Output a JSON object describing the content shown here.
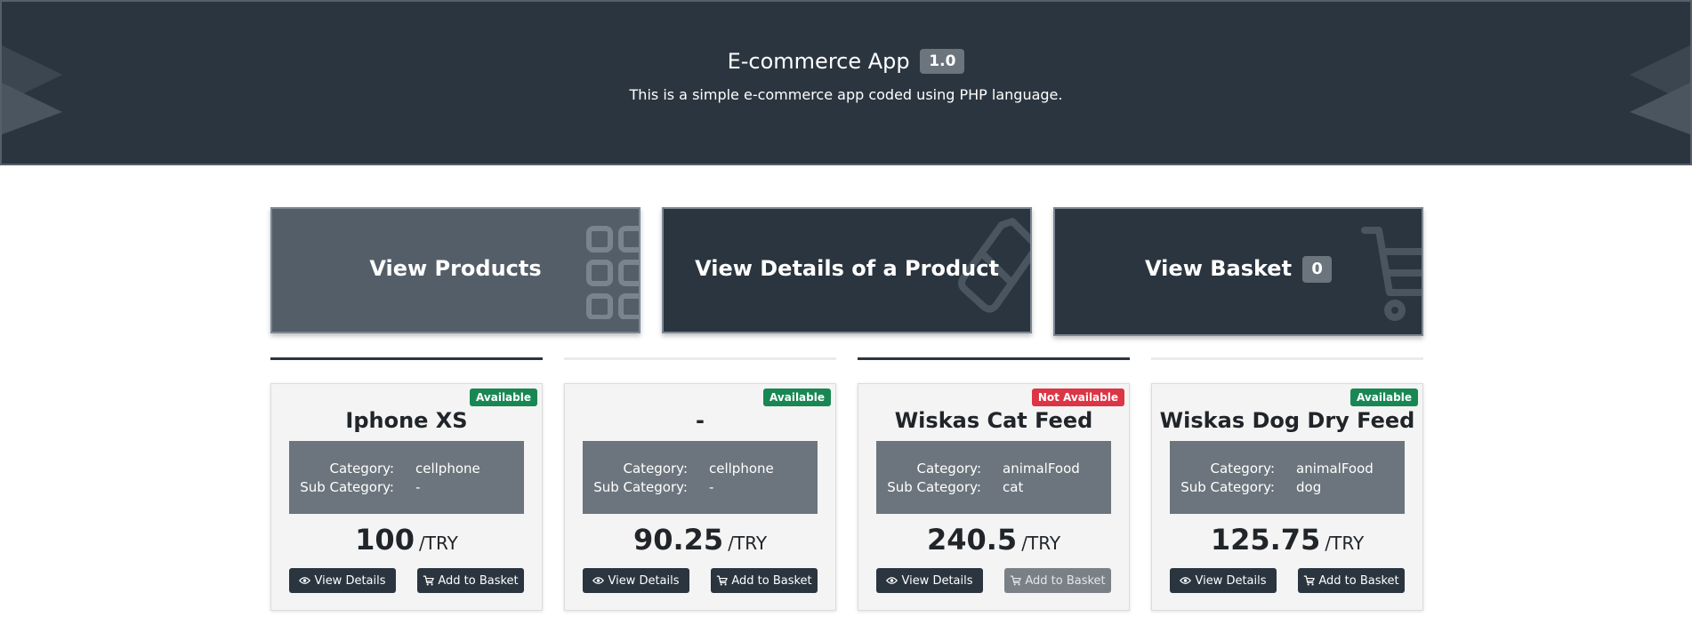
{
  "header": {
    "title": "E-commerce App",
    "version": "1.0",
    "subtitle": "This is a simple e-commerce app coded using PHP language."
  },
  "nav": {
    "products_label": "View Products",
    "details_label": "View Details of a Product",
    "basket_label": "View Basket",
    "basket_count": "0"
  },
  "products": [
    {
      "status": "Available",
      "name": "Iphone XS",
      "category_key": "Category:",
      "category": "cellphone",
      "subcategory_key": "Sub Category:",
      "subcategory": "-",
      "price": "100",
      "currency": "/TRY",
      "details_label": "View Details",
      "basket_label": "Add to Basket"
    },
    {
      "status": "Available",
      "name": "-",
      "category_key": "Category:",
      "category": "cellphone",
      "subcategory_key": "Sub Category:",
      "subcategory": "-",
      "price": "90.25",
      "currency": "/TRY",
      "details_label": "View Details",
      "basket_label": "Add to Basket"
    },
    {
      "status": "Not Available",
      "name": "Wiskas Cat Feed",
      "category_key": "Category:",
      "category": "animalFood",
      "subcategory_key": "Sub Category:",
      "subcategory": "cat",
      "price": "240.5",
      "currency": "/TRY",
      "details_label": "View Details",
      "basket_label": "Add to Basket"
    },
    {
      "status": "Available",
      "name": "Wiskas Dog Dry Feed",
      "category_key": "Category:",
      "category": "animalFood",
      "subcategory_key": "Sub Category:",
      "subcategory": "dog",
      "price": "125.75",
      "currency": "/TRY",
      "details_label": "View Details",
      "basket_label": "Add to Basket"
    }
  ],
  "colors": {
    "primary_dark": "#2b353f",
    "secondary": "#6c757d",
    "success": "#198754",
    "danger": "#dc3545"
  },
  "icons": {
    "header": "layers-icon",
    "products_tile": "grid-icon",
    "details_tile": "tag-icon",
    "basket_tile": "cart-icon",
    "view_details": "eye-icon",
    "add_to_basket": "cart-icon"
  }
}
